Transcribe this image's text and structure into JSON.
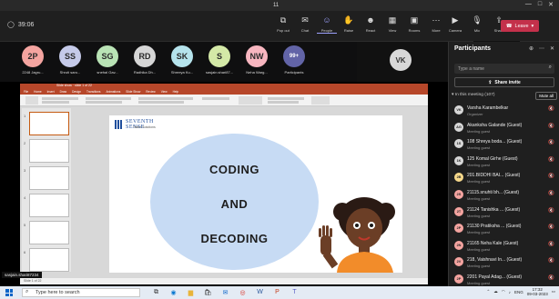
{
  "window": {
    "title": "11",
    "controls": [
      "—",
      "□",
      "✕"
    ]
  },
  "meeting": {
    "timer": "39:06"
  },
  "toolbar": {
    "left_items": [
      {
        "label": "Pop out",
        "icon": "pop-out-icon"
      },
      {
        "label": "Chat",
        "icon": "chat-icon"
      },
      {
        "label": "People",
        "icon": "people-icon"
      },
      {
        "label": "Raise",
        "icon": "raise-hand-icon"
      },
      {
        "label": "React",
        "icon": "react-icon"
      },
      {
        "label": "View",
        "icon": "view-icon"
      },
      {
        "label": "Rooms",
        "icon": "rooms-icon"
      },
      {
        "label": "More",
        "icon": "more-icon"
      }
    ],
    "right_items": [
      {
        "label": "Camera",
        "icon": "camera-icon"
      },
      {
        "label": "Mic",
        "icon": "mic-icon"
      },
      {
        "label": "Share",
        "icon": "share-icon"
      }
    ],
    "leave_label": "Leave",
    "tooltip": "Unmute (Ctrl+Shift+M)"
  },
  "strip": {
    "participants": [
      {
        "initials": "2P",
        "name": "2248 Jagru...",
        "color": "#f4a4a0"
      },
      {
        "initials": "SS",
        "name": "Shruti saro...",
        "color": "#c5cae9"
      },
      {
        "initials": "SG",
        "name": "snehal Gav...",
        "color": "#b9e3b5"
      },
      {
        "initials": "RD",
        "name": "Radhika Dh...",
        "color": "#d6d6d6"
      },
      {
        "initials": "SK",
        "name": "Shreeya Ku...",
        "color": "#b5e3ec"
      },
      {
        "initials": "S",
        "name": "sasjain.shari87...",
        "color": "#d4e9a7"
      },
      {
        "initials": "NW",
        "name": "Neha Warg...",
        "color": "#f8b6c0"
      },
      {
        "initials": "99+",
        "name": "Participants",
        "color": "#6264a7"
      }
    ],
    "large_tile": {
      "initials": "VK"
    }
  },
  "ppt": {
    "title_text": "Slide show · slide 1 of 22",
    "tabs": [
      "File",
      "Home",
      "Insert",
      "Draw",
      "Design",
      "Transitions",
      "Animations",
      "Slide Show",
      "Review",
      "View",
      "Help"
    ],
    "status": "Slide 1 of 22",
    "slide": {
      "logo_name": "SEVENTH SENSE",
      "logo_sub": "Talent Solutions",
      "words": [
        "CODING",
        "AND",
        "DECODING"
      ]
    },
    "presenter_label": "sasjain.shari87234"
  },
  "panel": {
    "title": "Participants",
    "search_placeholder": "Type a name",
    "share_invite": "Share invite",
    "section_label": "In this meeting (107)",
    "mute_all": "Mute all",
    "people": [
      {
        "initials": "VK",
        "name": "Varsha Karambelkar",
        "role": "Organizer",
        "color": "#d8d8d8"
      },
      {
        "initials": "AG",
        "name": "Akanksha Galande (Guest)",
        "role": "Meeting guest",
        "color": "#d8d8d8"
      },
      {
        "initials": "1S",
        "name": "108 Shreya boda... (Guest)",
        "role": "Meeting guest",
        "color": "#d8d8d8"
      },
      {
        "initials": "1K",
        "name": "125 Komal Girhe (Guest)",
        "role": "Meeting guest",
        "color": "#d8d8d8"
      },
      {
        "initials": "2B",
        "name": "201.BIDDHI BAI... (Guest)",
        "role": "Meeting guest",
        "color": "#f7d98b"
      },
      {
        "initials": "2S",
        "name": "21115.snuhti bh... (Guest)",
        "role": "Meeting guest",
        "color": "#f4a4a0"
      },
      {
        "initials": "2T",
        "name": "21124 Tanishka ... (Guest)",
        "role": "Meeting guest",
        "color": "#f4a4a0"
      },
      {
        "initials": "2P",
        "name": "21130 Pratiksha ... (Guest)",
        "role": "Meeting guest",
        "color": "#f4a4a0"
      },
      {
        "initials": "2N",
        "name": "21165 Neha Kale (Guest)",
        "role": "Meeting guest",
        "color": "#f4a4a0"
      },
      {
        "initials": "2V",
        "name": "218, Vaishnavi In... (Guest)",
        "role": "Meeting guest",
        "color": "#f4a4a0"
      },
      {
        "initials": "2P",
        "name": "2201 Payal Adag... (Guest)",
        "role": "Meeting guest",
        "color": "#f4a4a0"
      }
    ]
  },
  "taskbar": {
    "search_placeholder": "Type here to search",
    "apps": [
      {
        "icon": "task-view-icon",
        "glyph": "⧉"
      },
      {
        "icon": "edge-icon",
        "glyph": "◉"
      },
      {
        "icon": "file-explorer-icon",
        "glyph": "▆"
      },
      {
        "icon": "store-icon",
        "glyph": "🛍"
      },
      {
        "icon": "mail-icon",
        "glyph": "✉"
      },
      {
        "icon": "chrome-icon",
        "glyph": "◎"
      },
      {
        "icon": "word-icon",
        "glyph": "W"
      },
      {
        "icon": "powerpoint-icon",
        "glyph": "P"
      },
      {
        "icon": "teams-icon",
        "glyph": "T"
      }
    ],
    "language": "ENG",
    "time": "17:32",
    "date": "09-03-2023"
  }
}
